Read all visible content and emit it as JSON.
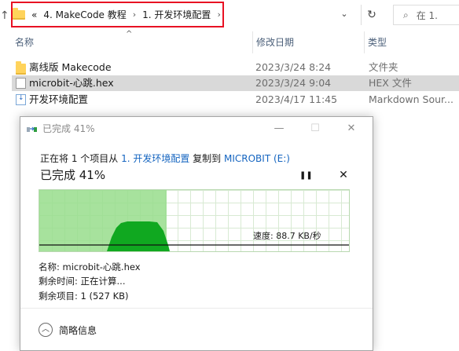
{
  "explorer": {
    "breadcrumb": {
      "overflow": "«",
      "parent": "4. MakeCode 教程",
      "current": "1. 开发环境配置"
    },
    "search_placeholder": "在 1."
  },
  "columns": {
    "name": "名称",
    "date": "修改日期",
    "type": "类型"
  },
  "files": [
    {
      "name": "离线版 Makecode",
      "date": "2023/3/24 8:24",
      "type": "文件夹",
      "icon": "folder-icon"
    },
    {
      "name": "microbit-心跳.hex",
      "date": "2023/3/24 9:04",
      "type": "HEX 文件",
      "icon": "file-icon"
    },
    {
      "name": "开发环境配置",
      "date": "2023/4/17 11:45",
      "type": "Markdown Sour...",
      "icon": "markdown-file-icon"
    }
  ],
  "dialog": {
    "title": "已完成 41%",
    "desc_prefix": "正在将 1 个项目从 ",
    "source": "1. 开发环境配置",
    "desc_mid": " 复制到 ",
    "dest": "MICROBIT (E:)",
    "progress_text": "已完成 41%",
    "progress_fraction": 0.41,
    "speed": "速度: 88.7 KB/秒",
    "name_line": "名称: microbit-心跳.hex",
    "time_line": "剩余时间: 正在计算...",
    "items_line": "剩余项目: 1 (527 KB)",
    "details_label": "简略信息",
    "accent": "#98dd8c",
    "graph_fill": "#10a820"
  }
}
